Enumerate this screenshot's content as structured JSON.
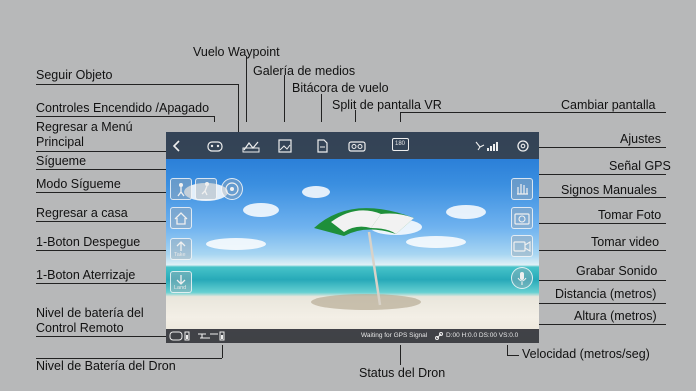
{
  "callouts": {
    "follow_object": "Seguir Objeto",
    "waypoint": "Vuelo Waypoint",
    "media_gallery": "Galería de medios",
    "flight_log": "Bitácora de vuelo",
    "vr": "Split de pantalla VR",
    "power": "Controles Encendido /Apagado",
    "switch_screen": "Cambiar pantalla",
    "back_line1": "Regresar a Menú",
    "back_line2": "Principal",
    "settings": "Ajustes",
    "follow_me": "Sígueme",
    "gps_signal": "Señal GPS",
    "follow_mode": "Modo Sígueme",
    "gestures": "Signos Manuales",
    "return_home": "Regresar a casa",
    "take_photo": "Tomar Foto",
    "takeoff": "1-Boton Despegue",
    "take_video": "Tomar video",
    "landing": "1-Boton Aterrizaje",
    "record_sound": "Grabar Sonido",
    "distance": "Distancia (metros)",
    "remote_batt_line1": "Nivel de batería del",
    "remote_batt_line2": "Control Remoto",
    "height": "Altura (metros)",
    "drone_batt": "Nivel de Batería del Dron",
    "speed": "Velocidad (metros/seg)",
    "drone_status": "Status del Dron"
  },
  "screen": {
    "status_text": "Waiting for GPS Signal",
    "telemetry": "D:00 H:0.0 DS:00 VS:0.0",
    "camera_mode_label": "180",
    "takeoff_label": "Take",
    "landing_label": "Land"
  },
  "icons": [
    "back-icon",
    "power-icon",
    "waypoint-icon",
    "gallery-icon",
    "log-icon",
    "vr-icon",
    "switch-screen-icon",
    "gps-signal-icon",
    "settings-icon",
    "follow-me-icon",
    "follow-object-icon",
    "follow-mode-icon",
    "home-icon",
    "takeoff-icon",
    "landing-icon",
    "gesture-icon",
    "camera-icon",
    "video-icon",
    "mic-icon",
    "remote-battery-icon",
    "drone-battery-icon",
    "link-icon"
  ],
  "colors": {
    "background": "#b7b8b9",
    "bar": "#373c44",
    "umbrella_green": "#1e8f3a"
  }
}
